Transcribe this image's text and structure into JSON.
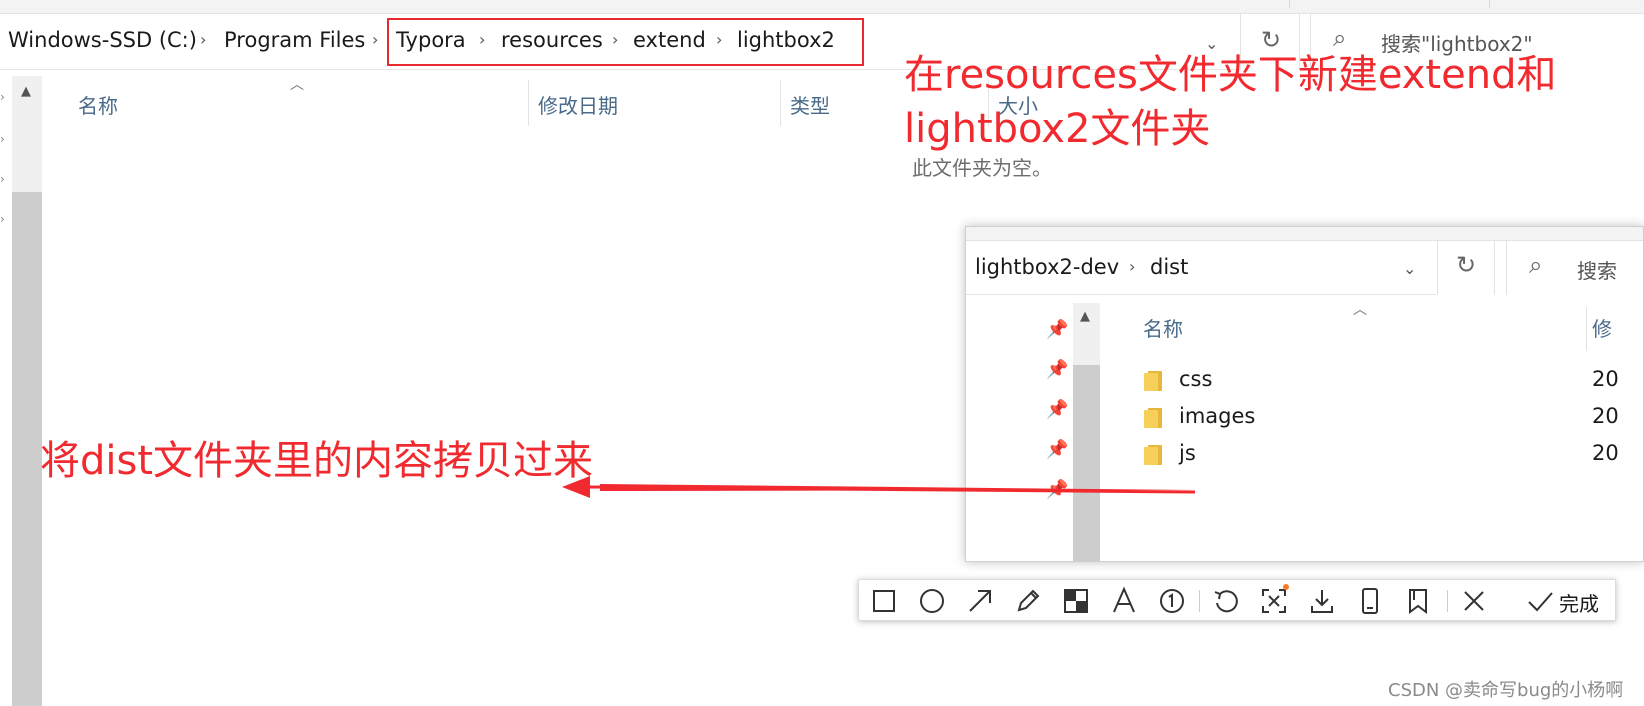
{
  "main_window": {
    "breadcrumbs": [
      "Windows-SSD (C:)",
      "Program Files",
      "Typora",
      "resources",
      "extend",
      "lightbox2"
    ],
    "search_placeholder": "搜索\"lightbox2\"",
    "columns": [
      "名称",
      "修改日期",
      "类型",
      "大小"
    ],
    "empty_message": "此文件夹为空。"
  },
  "annotations": {
    "create_folders_line1": "在resources文件夹下新建extend和",
    "create_folders_line2": "lightbox2文件夹",
    "copy_contents": "将dist文件夹里的内容拷贝过来",
    "accent_color": "#f12a2f"
  },
  "secondary_window": {
    "breadcrumbs": [
      "lightbox2-dev",
      "dist"
    ],
    "search_placeholder": "搜索",
    "columns": [
      "名称",
      "修"
    ],
    "items": [
      {
        "name": "css",
        "date": "20"
      },
      {
        "name": "images",
        "date": "20"
      },
      {
        "name": "js",
        "date": "20"
      }
    ]
  },
  "toolbar": {
    "tools": [
      "rectangle-icon",
      "ellipse-icon",
      "arrow-icon",
      "pencil-icon",
      "mosaic-icon",
      "text-icon",
      "number-icon",
      "undo-icon",
      "ocr-icon",
      "download-icon",
      "phone-icon",
      "bookmark-icon",
      "close-icon",
      "check-icon"
    ],
    "done_label": "完成"
  },
  "watermark": "CSDN @卖命写bug的小杨啊"
}
